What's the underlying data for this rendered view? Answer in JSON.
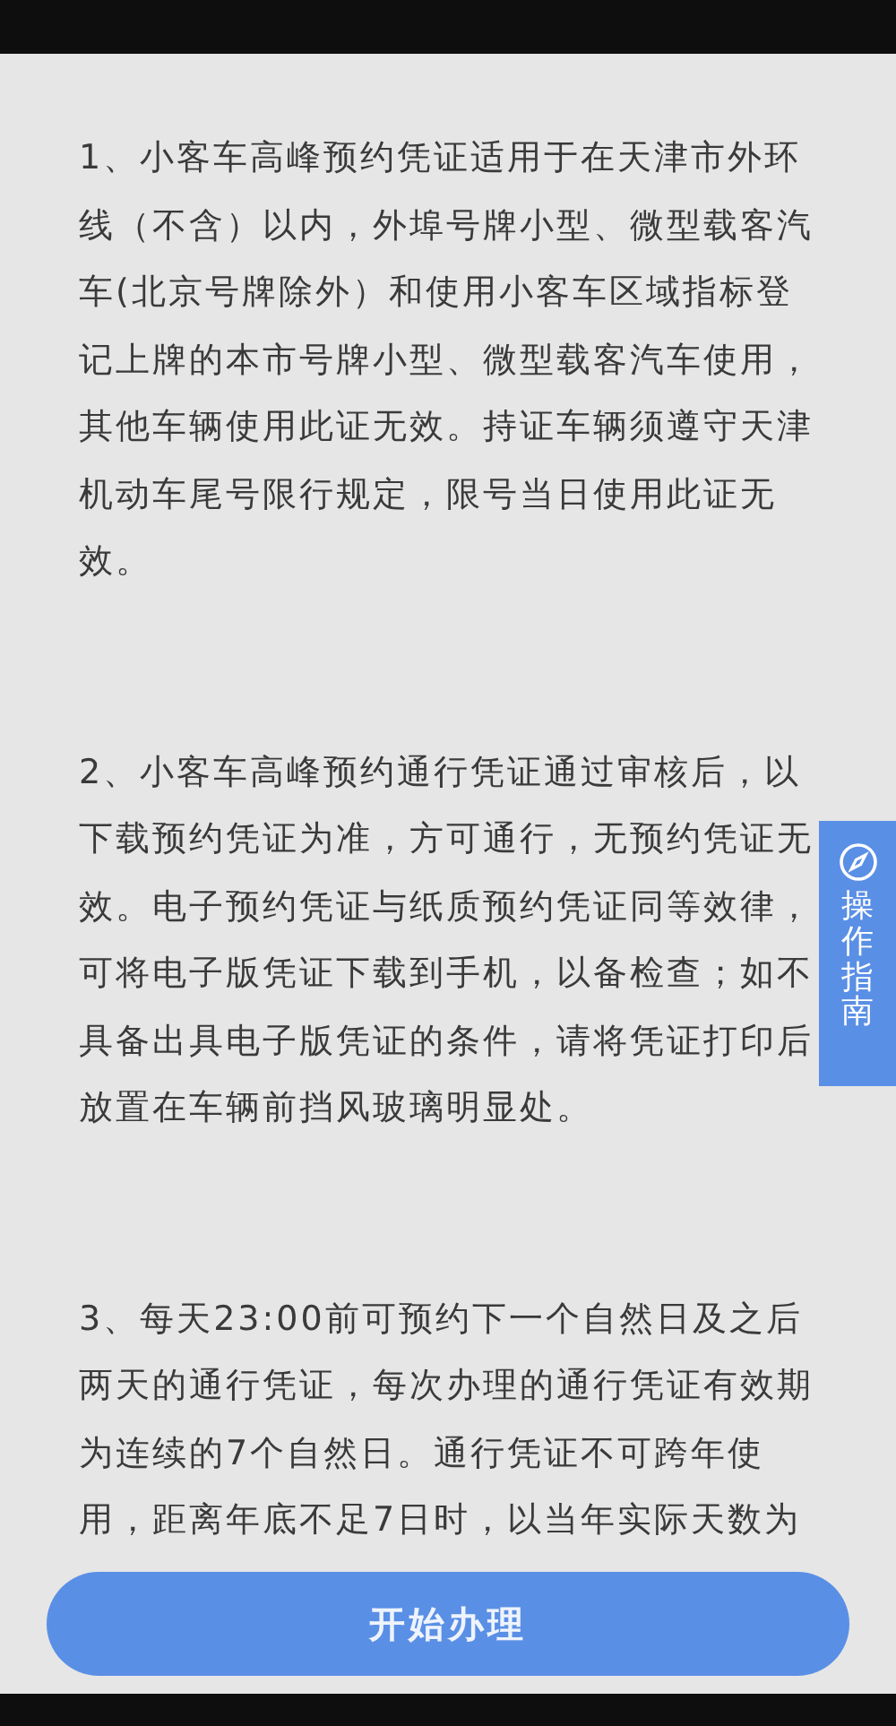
{
  "paragraphs": [
    "1、小客车高峰预约凭证适用于在天津市外环线（不含）以内，外埠号牌小型、微型载客汽车(北京号牌除外）和使用小客车区域指标登记上牌的本市号牌小型、微型载客汽车使用，其他车辆使用此证无效。持证车辆须遵守天津机动车尾号限行规定，限号当日使用此证无效。",
    "2、小客车高峰预约通行凭证通过审核后，以下载预约凭证为准，方可通行，无预约凭证无效。电子预约凭证与纸质预约凭证同等效律，可将电子版凭证下载到手机，以备检查；如不具备出具电子版凭证的条件，请将凭证打印后放置在车辆前挡风玻璃明显处。",
    "3、每天23:00前可预约下一个自然日及之后两天的通行凭证，每次办理的通行凭证有效期为连续的7个自然日。通行凭证不可跨年使用，距离年底不足7日时，以当年实际天数为"
  ],
  "side_tab": {
    "label": "操作指南"
  },
  "button": {
    "label": "开始办理"
  }
}
